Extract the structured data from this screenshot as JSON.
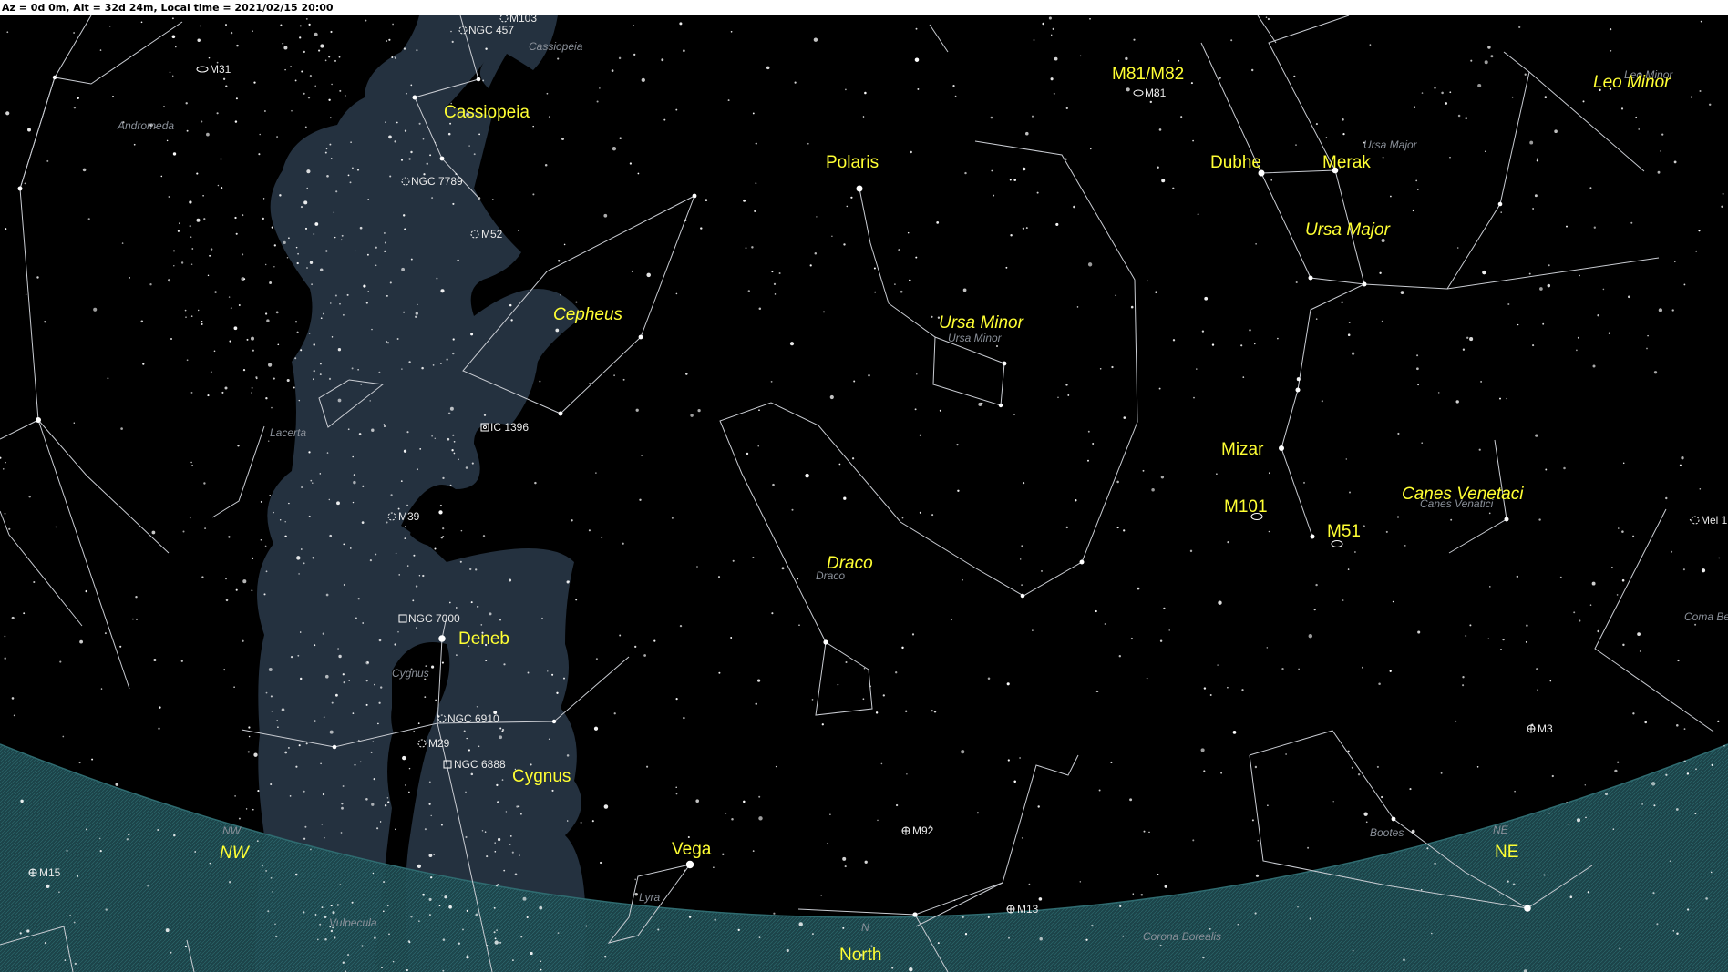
{
  "status_bar": "Az = 0d 0m, Alt = 32d 24m, Local time = 2021/02/15 20:00",
  "stars_named": [
    "Polaris",
    "Dubhe",
    "Merak",
    "Mizar",
    "Deneb",
    "Vega"
  ],
  "labels": {
    "cassiopeia": "Cassiopeia",
    "cepheus": "Cepheus",
    "ursa_minor": "Ursa Minor",
    "ursa_major": "Ursa Major",
    "draco": "Draco",
    "canes_venatici": "Canes Venetaci",
    "leo_minor": "Leo Minor",
    "cygnus": "Cygnus",
    "m81m82": "M81/M82",
    "m101": "M101",
    "m51": "M51",
    "nw": "NW",
    "ne": "NE",
    "north": "North"
  },
  "const_names": {
    "cassiopeia": "Cassiopeia",
    "andromeda": "Andromeda",
    "lacerta": "Lacerta",
    "cygnus": "Cygnus",
    "vulpecula": "Vulpecula",
    "lyra": "Lyra",
    "draco": "Draco",
    "ursa_minor": "Ursa Minor",
    "ursa_major": "Ursa Major",
    "leo_minor": "Leo Minor",
    "canes_venatici": "Canes Venatici",
    "coma": "Coma Be",
    "bootes": "Bootes",
    "corona_borealis": "Corona Borealis",
    "nw_small": "NW",
    "ne_small": "NE",
    "n_small": "N"
  },
  "dso": {
    "m103": "M103",
    "ngc457": "NGC 457",
    "m31": "M31",
    "ngc7789": "NGC 7789",
    "m52": "M52",
    "ic1396": "IC 1396",
    "m39": "M39",
    "ngc7000": "NGC 7000",
    "ngc6910": "NGC 6910",
    "m29": "M29",
    "ngc6888": "NGC 6888",
    "m15": "M15",
    "m81": "M81",
    "m92": "M92",
    "m13": "M13",
    "m3": "M3",
    "mel111": "Mel 1"
  },
  "colors": {
    "sky": "#000000",
    "milky_way": "#24313f",
    "horizon": "#1f4c52",
    "label_yellow": "#ffff33",
    "constellation_line": "#c9ccd2"
  }
}
